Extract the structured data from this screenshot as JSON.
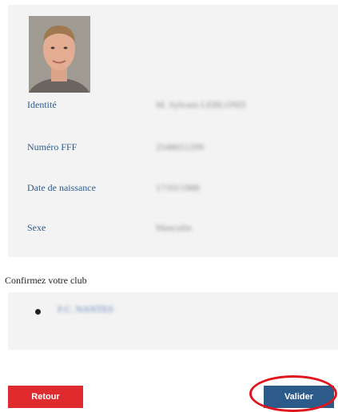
{
  "profile": {
    "fields": [
      {
        "label": "Identité",
        "value": "M. Sylvain LEBLOND"
      },
      {
        "label": "Numéro FFF",
        "value": "2548651299"
      },
      {
        "label": "Date de naissance",
        "value": "17/03/1988"
      },
      {
        "label": "Sexe",
        "value": "Masculin"
      }
    ]
  },
  "club": {
    "title": "Confirmez votre club",
    "selected_club": "F.C. NANTES"
  },
  "actions": {
    "back_label": "Retour",
    "validate_label": "Valider"
  },
  "colors": {
    "label_blue": "#2f5a8f",
    "back_red": "#e02b2e",
    "validate_blue": "#2c5b8a",
    "annotation_red": "#e0141c"
  }
}
